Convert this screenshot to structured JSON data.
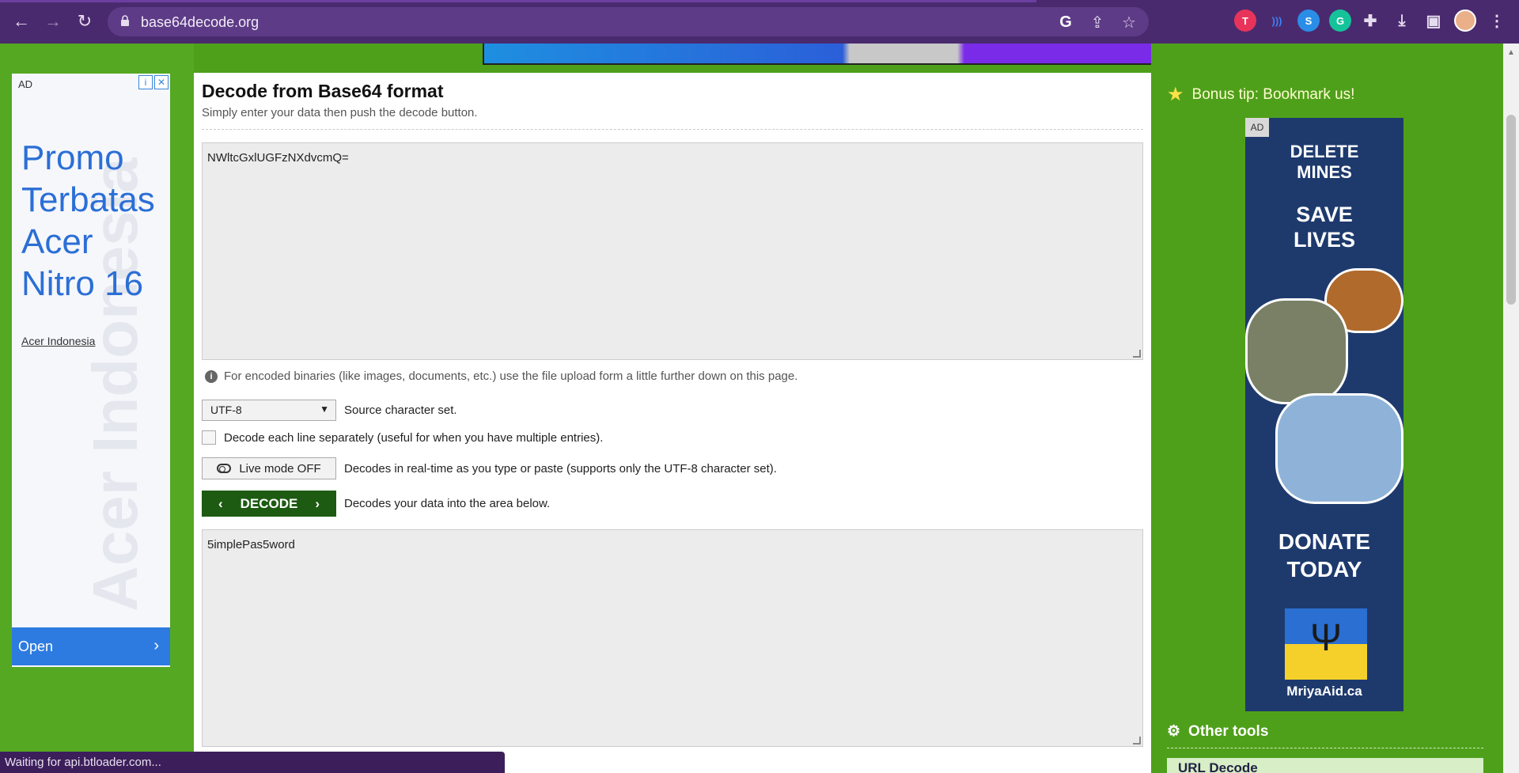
{
  "browser": {
    "url": "base64decode.org",
    "extensions": [
      {
        "name": "t-ext",
        "glyph": "T",
        "color": "#e8345a"
      },
      {
        "name": "wave-ext",
        "glyph": ")",
        "color": "#3b82f6"
      },
      {
        "name": "s-ext",
        "glyph": "S",
        "color": "#2a8ee8"
      },
      {
        "name": "grammarly-ext",
        "glyph": "G",
        "color": "#15c39a"
      }
    ]
  },
  "left_ad": {
    "label": "AD",
    "headline": "Promo Terbatas Acer Nitro 16",
    "brand": "Acer Indonesia",
    "watermark": "Acer Indonesia",
    "open_label": "Open"
  },
  "main": {
    "title": "Decode from Base64 format",
    "subtitle": "Simply enter your data then push the decode button.",
    "input_value": "NWltcGxlUGFzNXdvcmQ=",
    "info_text": "For encoded binaries (like images, documents, etc.) use the file upload form a little further down on this page.",
    "charset_value": "UTF-8",
    "charset_label": "Source character set.",
    "decode_lines_label": "Decode each line separately (useful for when you have multiple entries).",
    "live_mode_label": "Live mode OFF",
    "live_mode_desc": "Decodes in real-time as you type or paste (supports only the UTF-8 character set).",
    "decode_button": "DECODE",
    "decode_desc": "Decodes your data into the area below.",
    "output_value": "5implePas5word"
  },
  "sidebar": {
    "bonus_tip": "Bonus tip: Bookmark us!",
    "ad_label": "AD",
    "ad_line1": "DELETE MINES",
    "ad_line2": "SAVE LIVES",
    "ad_line3": "DONATE TODAY",
    "ad_brand": "MriyaAid.ca",
    "other_tools_title": "Other tools",
    "tool_first": "URL Decode"
  },
  "status_text": "Waiting for api.btloader.com..."
}
